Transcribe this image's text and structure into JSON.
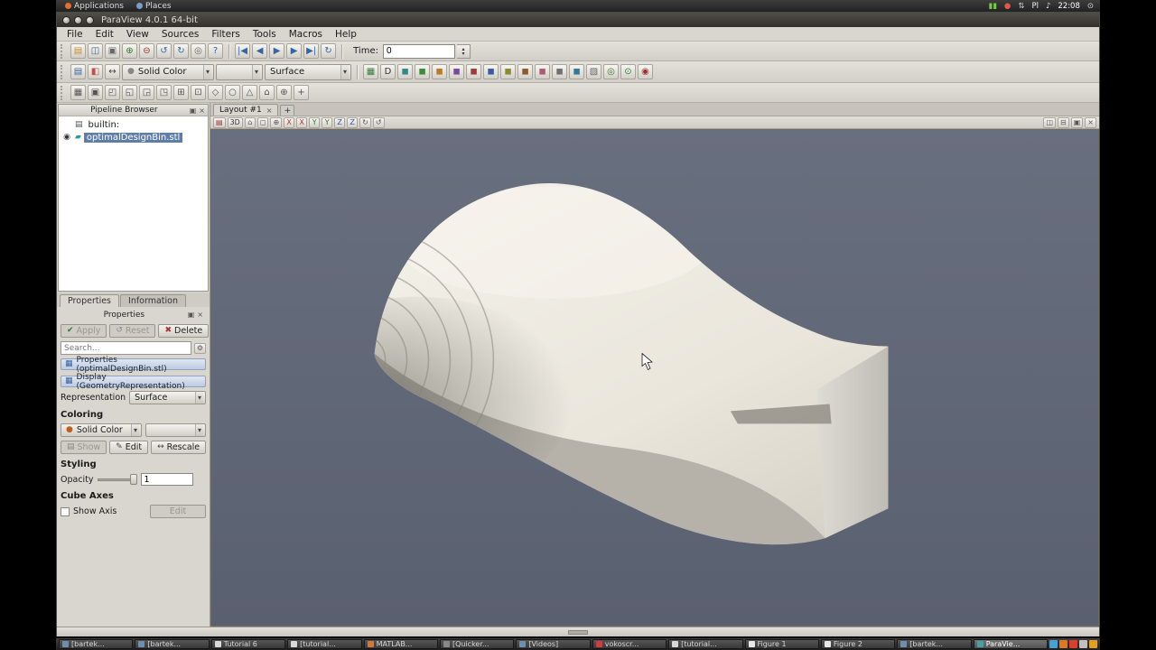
{
  "top_panel": {
    "menus": [
      {
        "name": "applications-menu",
        "label": "Applications",
        "icon_color": "#e07030"
      },
      {
        "name": "places-menu",
        "label": "Places",
        "icon_color": "#7a9cc8"
      }
    ],
    "tray": [
      {
        "name": "workspace-indicator-icon",
        "glyph": "▮▮",
        "color": "#79c843"
      },
      {
        "name": "notification-icon",
        "glyph": "●",
        "color": "#e2574c"
      },
      {
        "name": "network-icon",
        "glyph": "⇅",
        "color": "#cccccc"
      },
      {
        "name": "keyboard-layout-indicator",
        "glyph": "Pl",
        "color": "#eeeeee"
      },
      {
        "name": "volume-icon",
        "glyph": "♪",
        "color": "#eeeeee"
      },
      {
        "name": "clock",
        "glyph": "22:08",
        "color": "#ffffff"
      },
      {
        "name": "session-menu-icon",
        "glyph": "⊙",
        "color": "#dddddd"
      }
    ]
  },
  "window": {
    "title": "ParaView 4.0.1 64-bit",
    "menus": [
      "File",
      "Edit",
      "View",
      "Sources",
      "Filters",
      "Tools",
      "Macros",
      "Help"
    ],
    "toolbar_main": [
      {
        "name": "open-file-icon",
        "glyph": "▤",
        "color": "#c09030"
      },
      {
        "name": "save-state-icon",
        "glyph": "◫",
        "color": "#3465a4"
      },
      {
        "name": "save-screenshot-icon",
        "glyph": "▣",
        "color": "#666666"
      },
      {
        "name": "connect-server-icon",
        "glyph": "⊕",
        "color": "#2a7a2a"
      },
      {
        "name": "disconnect-server-icon",
        "glyph": "⊖",
        "color": "#a03030"
      },
      {
        "name": "undo-icon",
        "glyph": "↺",
        "color": "#3465a4"
      },
      {
        "name": "redo-icon",
        "glyph": "↻",
        "color": "#3465a4"
      },
      {
        "name": "auto-apply-icon",
        "glyph": "◎",
        "color": "#666666"
      },
      {
        "name": "help-icon",
        "glyph": "?",
        "color": "#3465a4"
      }
    ],
    "vcr": [
      {
        "name": "vcr-first-frame-icon",
        "glyph": "|◀",
        "color": "#3465a4"
      },
      {
        "name": "vcr-previous-frame-icon",
        "glyph": "◀",
        "color": "#3465a4"
      },
      {
        "name": "vcr-play-icon",
        "glyph": "▶",
        "color": "#3465a4"
      },
      {
        "name": "vcr-next-frame-icon",
        "glyph": "▶",
        "color": "#3465a4"
      },
      {
        "name": "vcr-last-frame-icon",
        "glyph": "▶|",
        "color": "#3465a4"
      },
      {
        "name": "vcr-loop-icon",
        "glyph": "↻",
        "color": "#3465a4"
      }
    ],
    "time_label": "Time:",
    "time_value": "0",
    "spinner_up": "▴",
    "spinner_down": "▾",
    "variables_toolbar": {
      "icons_left": [
        {
          "name": "toggle-color-legend-icon",
          "glyph": "▤",
          "color": "#3465a4"
        },
        {
          "name": "edit-color-map-icon",
          "glyph": "◧",
          "color": "#c05050"
        },
        {
          "name": "rescale-to-data-range-icon",
          "glyph": "↔",
          "color": "#444444"
        }
      ],
      "color_by_icon": "●",
      "color_by": "Solid Color",
      "component": "",
      "representation": "Surface",
      "icons_right": [
        {
          "name": "show-orientation-axes-icon",
          "glyph": "▦",
          "color": "#3a7a3a"
        },
        {
          "name": "edit-view-options-icon",
          "glyph": "D",
          "color": "#333333"
        },
        {
          "name": "calculator-filter-icon",
          "glyph": "◼",
          "color": "#2e8b8b"
        },
        {
          "name": "contour-filter-icon",
          "glyph": "◼",
          "color": "#3a8b3a"
        },
        {
          "name": "clip-filter-icon",
          "glyph": "◼",
          "color": "#c07820"
        },
        {
          "name": "slice-filter-icon",
          "glyph": "◼",
          "color": "#7a4a9a"
        },
        {
          "name": "threshold-filter-icon",
          "glyph": "◼",
          "color": "#a03a3a"
        },
        {
          "name": "extract-subset-filter-icon",
          "glyph": "◼",
          "color": "#3a5aa0"
        },
        {
          "name": "glyph-filter-icon",
          "glyph": "◼",
          "color": "#8b8b2e"
        },
        {
          "name": "stream-tracer-filter-icon",
          "glyph": "◼",
          "color": "#8b5a2e"
        },
        {
          "name": "warp-by-vector-filter-icon",
          "glyph": "◼",
          "color": "#b05a7a"
        },
        {
          "name": "group-datasets-filter-icon",
          "glyph": "◼",
          "color": "#707070"
        },
        {
          "name": "extract-level-filter-icon",
          "glyph": "◼",
          "color": "#2e7a9a"
        },
        {
          "name": "fast-preview-icon",
          "glyph": "▧",
          "color": "#666666"
        },
        {
          "name": "camera-link-icon",
          "glyph": "◎",
          "color": "#2a7a2a"
        },
        {
          "name": "center-axes-visibility-icon",
          "glyph": "⊙",
          "color": "#2a7a2a"
        },
        {
          "name": "pick-center-icon",
          "glyph": "◉",
          "color": "#a03030"
        }
      ]
    },
    "selection_toolbar": [
      {
        "name": "select-cells-on-surface-icon",
        "glyph": "▦",
        "color": "#555555"
      },
      {
        "name": "select-points-on-surface-icon",
        "glyph": "▣",
        "color": "#555555"
      },
      {
        "name": "select-cells-through-icon",
        "glyph": "◰",
        "color": "#555555"
      },
      {
        "name": "select-points-through-icon",
        "glyph": "◱",
        "color": "#555555"
      },
      {
        "name": "select-cells-polygon-icon",
        "glyph": "◲",
        "color": "#555555"
      },
      {
        "name": "select-points-polygon-icon",
        "glyph": "◳",
        "color": "#555555"
      },
      {
        "name": "select-block-icon",
        "glyph": "⊞",
        "color": "#555555"
      },
      {
        "name": "interactive-select-cells-icon",
        "glyph": "⊡",
        "color": "#555555"
      },
      {
        "name": "interactive-select-points-icon",
        "glyph": "◇",
        "color": "#555555"
      },
      {
        "name": "hover-cells-icon",
        "glyph": "○",
        "color": "#555555"
      },
      {
        "name": "hover-points-icon",
        "glyph": "△",
        "color": "#555555"
      },
      {
        "name": "reset-camera-icon",
        "glyph": "⌂",
        "color": "#555555"
      },
      {
        "name": "zoom-to-data-icon",
        "glyph": "⊕",
        "color": "#555555"
      },
      {
        "name": "add-measurement-icon",
        "glyph": "+",
        "color": "#555555"
      }
    ]
  },
  "pipeline": {
    "header": "Pipeline Browser",
    "float_icon": "▣",
    "close_icon": "×",
    "items": [
      {
        "name": "pipeline-item-builtin",
        "eye": "",
        "icon": "▤",
        "icon_color": "#555555",
        "label": "builtin:"
      },
      {
        "name": "pipeline-item-optimaldesignbin",
        "eye": "◉",
        "icon": "▰",
        "icon_color": "#2a9a9a",
        "label": "optimalDesignBin.stl",
        "selected": true
      }
    ]
  },
  "properties": {
    "tabs": [
      {
        "name": "tab-properties",
        "label": "Properties",
        "active": true
      },
      {
        "name": "tab-information",
        "label": "Information"
      }
    ],
    "panel_title": "Properties",
    "float_icon": "▣",
    "close_icon": "×",
    "action_buttons": [
      {
        "name": "apply-button",
        "glyph": "✔",
        "icon_color": "#2a7a2a",
        "label": "Apply",
        "disabled": true
      },
      {
        "name": "reset-button",
        "glyph": "↺",
        "icon_color": "#888888",
        "label": "Reset",
        "disabled": true
      },
      {
        "name": "delete-button",
        "glyph": "✖",
        "icon_color": "#b03030",
        "label": "Delete"
      },
      {
        "name": "help-button",
        "glyph": "",
        "icon_color": "#3465a4",
        "label": "?"
      }
    ],
    "search_placeholder": "Search...",
    "gear_icon": "⚙",
    "sections": [
      {
        "name": "section-properties-source",
        "icon": "▦",
        "icon_color": "#3465a4",
        "label": "Properties (optimalDesignBin.stl)"
      },
      {
        "name": "section-display",
        "icon": "▦",
        "icon_color": "#3465a4",
        "label": "Display (GeometryRepresentation)"
      }
    ],
    "representation": {
      "label": "Representation",
      "value": "Surface"
    },
    "coloring": {
      "heading": "Coloring",
      "dot_icon": "●",
      "dot_color": "#c06020",
      "value": "Solid Color",
      "component_value": "",
      "buttons": [
        {
          "name": "show-color-legend-button",
          "glyph": "▤",
          "icon_color": "#888888",
          "label": "Show",
          "disabled": true
        },
        {
          "name": "edit-color-map-button",
          "glyph": "✎",
          "icon_color": "#444444",
          "label": "Edit"
        },
        {
          "name": "rescale-button",
          "glyph": "↔",
          "icon_color": "#444444",
          "label": "Rescale"
        }
      ]
    },
    "styling": {
      "heading": "Styling",
      "opacity_label": "Opacity",
      "opacity_value": "1"
    },
    "cube_axes": {
      "heading": "Cube Axes",
      "show_axis_label": "Show Axis",
      "edit_label": "Edit"
    }
  },
  "view": {
    "tab_label": "Layout #1",
    "tab_close": "×",
    "add_tab": "+",
    "toolbar": [
      {
        "name": "toggle-color-legend-view-icon",
        "glyph": "▤",
        "color": "#a03030"
      },
      {
        "name": "view-mode-3d-button",
        "glyph": "3D",
        "color": "#333333"
      },
      {
        "name": "reset-camera-view-icon",
        "glyph": "⌂",
        "color": "#555555"
      },
      {
        "name": "rubber-band-zoom-icon",
        "glyph": "◻",
        "color": "#555555"
      },
      {
        "name": "zoom-to-data-view-icon",
        "glyph": "⊕",
        "color": "#555555"
      },
      {
        "name": "view-plus-x-icon",
        "glyph": "X",
        "color": "#c03030"
      },
      {
        "name": "view-minus-x-icon",
        "glyph": "X",
        "color": "#c03030"
      },
      {
        "name": "view-plus-y-icon",
        "glyph": "Y",
        "color": "#2a7a2a"
      },
      {
        "name": "view-minus-y-icon",
        "glyph": "Y",
        "color": "#2a7a2a"
      },
      {
        "name": "view-plus-z-icon",
        "glyph": "Z",
        "color": "#3050b0"
      },
      {
        "name": "view-minus-z-icon",
        "glyph": "Z",
        "color": "#3050b0"
      },
      {
        "name": "rotate-90-cw-icon",
        "glyph": "↻",
        "color": "#555555"
      },
      {
        "name": "rotate-90-ccw-icon",
        "glyph": "↺",
        "color": "#555555"
      }
    ],
    "window_buttons": [
      {
        "name": "split-horizontal-icon",
        "glyph": "◫"
      },
      {
        "name": "split-vertical-icon",
        "glyph": "⊟"
      },
      {
        "name": "maximize-view-icon",
        "glyph": "▣"
      },
      {
        "name": "close-view-icon",
        "glyph": "×"
      }
    ]
  },
  "taskbar": {
    "items": [
      {
        "name": "task-bartek-1",
        "label": "[bartek...",
        "icon_color": "#6a8fb5"
      },
      {
        "name": "task-bartek-2",
        "label": "[bartek...",
        "icon_color": "#6a8fb5"
      },
      {
        "name": "task-tutorial-6",
        "label": "Tutorial 6",
        "icon_color": "#d8d8d8"
      },
      {
        "name": "task-tutorial-1",
        "label": "[tutorial...",
        "icon_color": "#d8d8d8"
      },
      {
        "name": "task-matlab",
        "label": "MATLAB...",
        "icon_color": "#d87830"
      },
      {
        "name": "task-quicker",
        "label": "[Quicker...",
        "icon_color": "#888888"
      },
      {
        "name": "task-videos",
        "label": "[Videos]",
        "icon_color": "#6a8fb5"
      },
      {
        "name": "task-vokoscreen",
        "label": "vokoscr...",
        "icon_color": "#c84040"
      },
      {
        "name": "task-tutorial-2",
        "label": "[tutorial...",
        "icon_color": "#d8d8d8"
      },
      {
        "name": "task-figure-1",
        "label": "Figure 1",
        "icon_color": "#e8e8e8"
      },
      {
        "name": "task-figure-2",
        "label": "Figure 2",
        "icon_color": "#e8e8e8"
      },
      {
        "name": "task-bartek-3",
        "label": "[bartek...",
        "icon_color": "#6a8fb5"
      },
      {
        "name": "task-paraview",
        "label": "ParaVie...",
        "icon_color": "#4aa0a0",
        "active": true
      }
    ],
    "tray": [
      {
        "name": "tray-app-blue-icon",
        "bg": "#4aa0d0"
      },
      {
        "name": "tray-app-orange-icon",
        "bg": "#e07820"
      },
      {
        "name": "tray-app-red-icon",
        "bg": "#d84030"
      },
      {
        "name": "tray-app-gray-icon",
        "bg": "#c0c0c0"
      },
      {
        "name": "tray-app-amber-icon",
        "bg": "#e0a020"
      }
    ]
  }
}
